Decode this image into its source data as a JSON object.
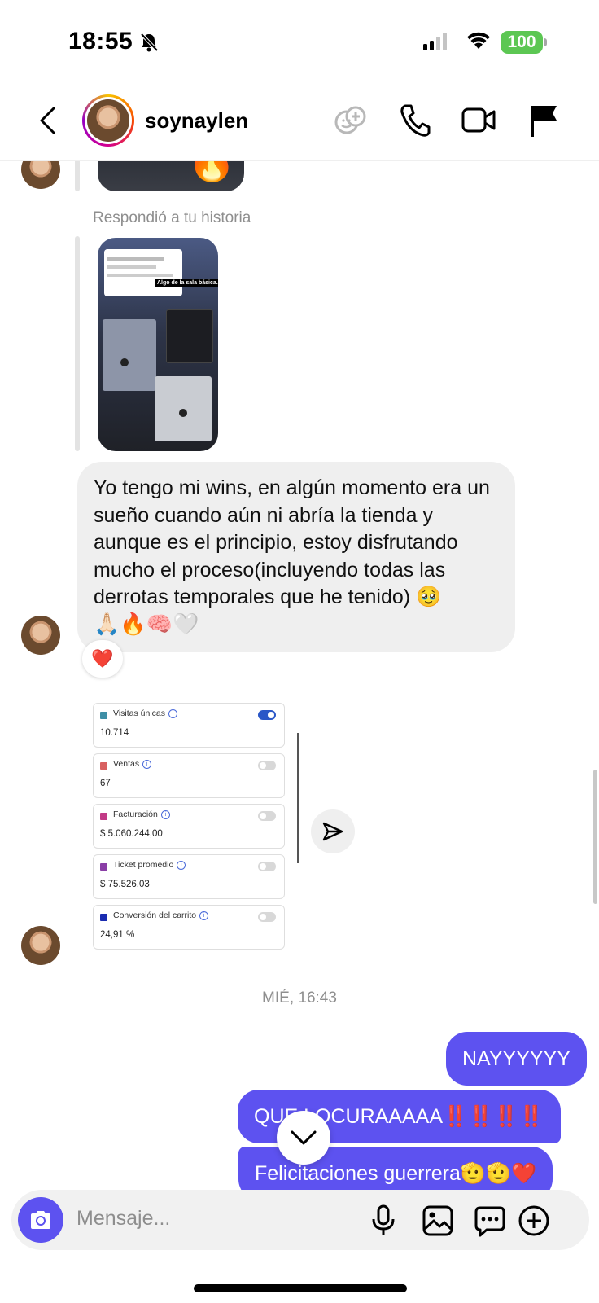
{
  "status_bar": {
    "time": "18:55",
    "battery": "100"
  },
  "header": {
    "username": "soynaylen"
  },
  "thread": {
    "reply_label": "Respondió a tu historia",
    "story_overlay_text": "Algo de la sala básica...",
    "incoming_message": "Yo tengo mi wins, en algún momento era un sueño cuando aún ni abría la tienda y aunque es el principio, estoy disfrutando mucho el proceso(incluyendo todas las derrotas temporales que he tenido) 🥹",
    "incoming_emojis": "🙏🏻🔥🧠🤍",
    "reaction": "❤️",
    "stats_cards": [
      {
        "label": "Visitas únicas",
        "value": "10.714",
        "color": "#3f8fa6",
        "toggle_on": true
      },
      {
        "label": "Ventas",
        "value": "67",
        "color": "#d86060",
        "toggle_on": false
      },
      {
        "label": "Facturación",
        "value": "$ 5.060.244,00",
        "color": "#c23a86",
        "toggle_on": false
      },
      {
        "label": "Ticket promedio",
        "value": "$ 75.526,03",
        "color": "#8a3ea6",
        "toggle_on": false
      },
      {
        "label": "Conversión del carrito",
        "value": "24,91 %",
        "color": "#1a2bb0",
        "toggle_on": false
      }
    ],
    "timestamp": "MIÉ, 16:43",
    "outgoing": [
      {
        "text": "NAYYYYYY"
      },
      {
        "text": "QUE LOCURAAAAA‼️‼️‼️‼️"
      },
      {
        "text": "Felicitaciones guerrera🫡🫡❤️"
      }
    ]
  },
  "composer": {
    "placeholder": "Mensaje..."
  },
  "colors": {
    "accent": "#5d52f0",
    "incoming_bubble": "#efefef",
    "muted_text": "#8e8e8e"
  },
  "icons": [
    "bell-off-icon",
    "signal-icon",
    "wifi-icon",
    "back-chevron-icon",
    "add-people-icon",
    "phone-icon",
    "video-icon",
    "flag-icon",
    "send-arrow-icon",
    "chevron-down-icon",
    "camera-icon",
    "microphone-icon",
    "gallery-icon",
    "sticker-icon",
    "plus-circle-icon"
  ]
}
